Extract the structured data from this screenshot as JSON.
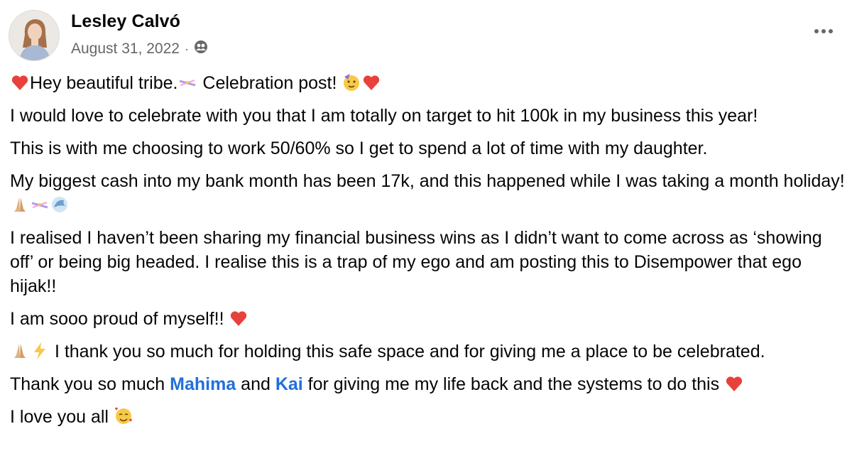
{
  "post": {
    "author": "Lesley Calvó",
    "date": "August 31, 2022",
    "separator": "·",
    "audience_icon": "friends-audience-icon",
    "more_icon": "more-options-icon"
  },
  "paragraphs": {
    "p1_a": "Hey beautiful tribe.",
    "p1_b": " Celebration post! ",
    "p2": "I would love to celebrate with you that I am totally on target to hit 100k in my business this year!",
    "p3": "This is with me choosing to work 50/60% so I get to spend a lot of time with my daughter.",
    "p4": "My biggest cash into my bank month has been 17k, and this happened while I was taking a month holiday! ",
    "p5": "I realised I haven’t been sharing my financial business wins as I didn’t want to come across as ‘showing off’ or being big headed. I realise this is a trap of my ego and am posting this to Disempower that ego hijak!!",
    "p6": "I am sooo proud of myself!! ",
    "p7": " I thank you so much for holding this safe space and for giving me a place to be celebrated.",
    "p8_a": "Thank you so much ",
    "p8_mention1": "Mahima",
    "p8_b": " and ",
    "p8_mention2": "Kai",
    "p8_c": " for giving me my life back and the systems to do this ",
    "p9": "I love you all "
  },
  "colors": {
    "heart": "#e8413b",
    "mention": "#216fdb",
    "secondary_text": "#65676b"
  }
}
